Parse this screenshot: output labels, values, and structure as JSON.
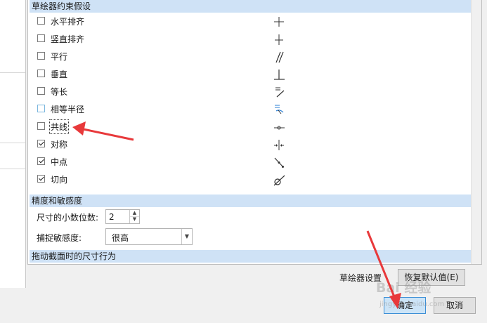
{
  "sections": {
    "constraints": "草绘器约束假设",
    "precision": "精度和敏感度",
    "drag": "拖动截面时的尺寸行为"
  },
  "constraints": [
    {
      "label": "水平排齐",
      "checked": false,
      "icon": "horizontal-constraint-icon"
    },
    {
      "label": "竖直排齐",
      "checked": false,
      "icon": "vertical-constraint-icon"
    },
    {
      "label": "平行",
      "checked": false,
      "icon": "parallel-constraint-icon"
    },
    {
      "label": "垂直",
      "checked": false,
      "icon": "perpendicular-constraint-icon"
    },
    {
      "label": "等长",
      "checked": false,
      "icon": "equal-length-constraint-icon"
    },
    {
      "label": "相等半径",
      "checked": false,
      "icon": "equal-radius-constraint-icon"
    },
    {
      "label": "共线",
      "checked": false,
      "icon": "collinear-constraint-icon"
    },
    {
      "label": "对称",
      "checked": true,
      "icon": "symmetric-constraint-icon"
    },
    {
      "label": "中点",
      "checked": true,
      "icon": "midpoint-constraint-icon"
    },
    {
      "label": "切向",
      "checked": true,
      "icon": "tangent-constraint-icon"
    }
  ],
  "precision": {
    "decimal_label": "尺寸的小数位数:",
    "decimal_value": "2",
    "sensitivity_label": "捕捉敏感度:",
    "sensitivity_value": "很高"
  },
  "footer": {
    "settings_label": "草绘器设置",
    "restore_button": "恢复默认值(E)",
    "ok_button": "确定",
    "cancel_button": "取消"
  },
  "watermark": {
    "main": "Bai 经验",
    "sub": "jingyan.baidu.com"
  },
  "colors": {
    "section_header": "#cfe2f6",
    "annotation_arrow": "#e8393b",
    "icon_accent": "#2a7fd4"
  }
}
